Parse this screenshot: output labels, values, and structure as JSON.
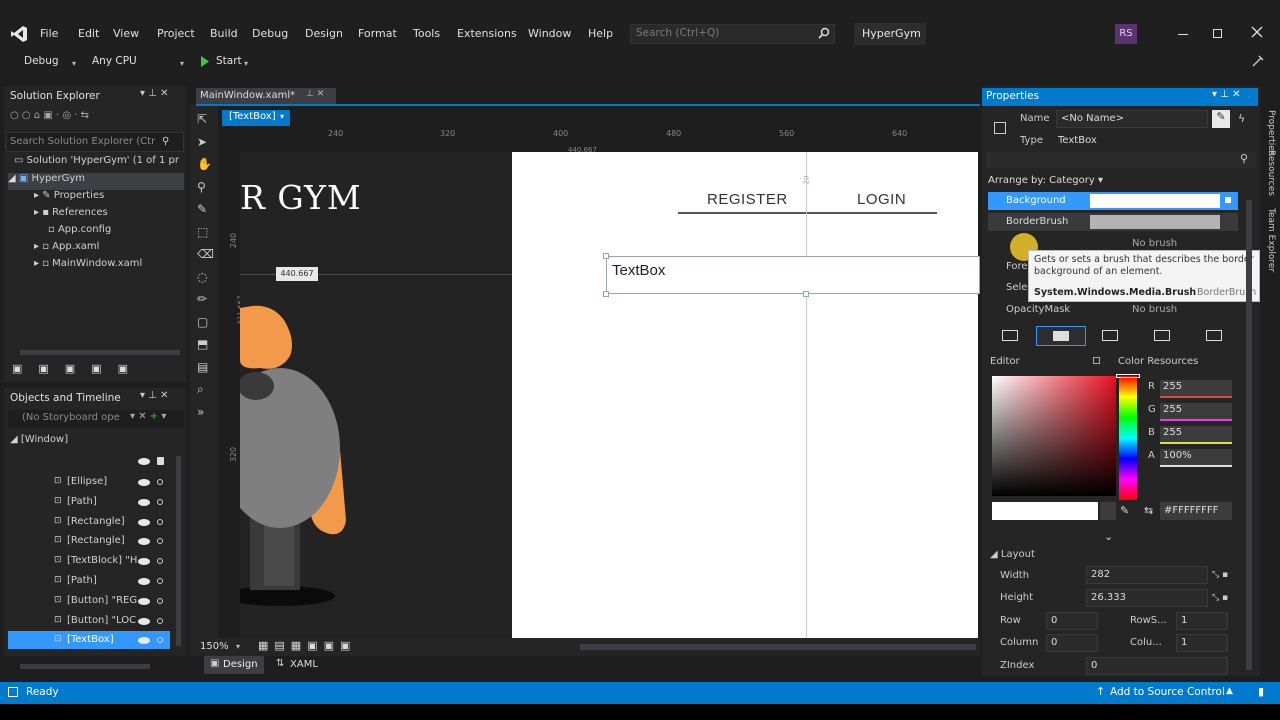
{
  "menu": [
    "File",
    "Edit",
    "View",
    "Project",
    "Build",
    "Debug",
    "Design",
    "Format",
    "Tools",
    "Extensions",
    "Window",
    "Help"
  ],
  "search": {
    "placeholder": "Search (Ctrl+Q)"
  },
  "solution_name": "HyperGym",
  "user_initials": "RS",
  "toolbar": {
    "config": "Debug",
    "platform": "Any CPU",
    "start": "Start"
  },
  "solution_explorer": {
    "title": "Solution Explorer",
    "search_placeholder": "Search Solution Explorer (Ctr",
    "items": [
      "Solution 'HyperGym' (1 of 1 pr",
      "HyperGym",
      "Properties",
      "References",
      "App.config",
      "App.xaml",
      "MainWindow.xaml"
    ]
  },
  "objects_timeline": {
    "title": "Objects and Timeline",
    "storyboard": "(No Storyboard ope",
    "root": "[Window]",
    "items": [
      "[Ellipse]",
      "[Path]",
      "[Rectangle]",
      "[Rectangle]",
      "[TextBlock] \"H",
      "[Path]",
      "[Button] \"REG",
      "[Button] \"LOC",
      "[TextBox]"
    ]
  },
  "document": {
    "tab": "MainWindow.xaml*",
    "selector": "[TextBox]",
    "ruler_top": [
      "240",
      "320",
      "400",
      "480",
      "560",
      "640"
    ],
    "ruler_left": [
      "240",
      "320"
    ],
    "dim_label_h": "440.667",
    "dim_label_top": "440.667",
    "dim_label_vert": "311.667",
    "dim_label_top_vert": "20",
    "logo_text": "R GYM",
    "nav_register": "REGISTER",
    "nav_login": "LOGIN",
    "textbox_text": "TextBox",
    "zoom": "150%",
    "design_tab": "Design",
    "xaml_tab": "XAML"
  },
  "properties": {
    "title": "Properties",
    "name_label": "Name",
    "name_value": "<No Name>",
    "type_label": "Type",
    "type_value": "TextBox",
    "arrange_by": "Arrange by: Category",
    "brush_rows": [
      "Background",
      "BorderBrush",
      "Foreground",
      "SelectionBrush",
      "OpacityMask"
    ],
    "no_brush": "No brush",
    "tooltip_line1": "Gets or sets a brush that describes the border",
    "tooltip_line2": "background of an element.",
    "tooltip_type": "System.Windows.Media.Brush",
    "tooltip_prop": "BorderBrush",
    "editor_label": "Editor",
    "color_resources": "Color Resources",
    "rgba_labels": [
      "R",
      "G",
      "B",
      "A"
    ],
    "rgba_values": [
      "255",
      "255",
      "255",
      "100%"
    ],
    "hex": "#FFFFFFFF",
    "layout_section": "Layout",
    "layout": {
      "width_label": "Width",
      "width": "282",
      "height_label": "Height",
      "height": "26.333",
      "row_label": "Row",
      "row": "0",
      "rowspan_label": "RowS...",
      "rowspan": "1",
      "column_label": "Column",
      "column": "0",
      "colspan_label": "Colu...",
      "colspan": "1",
      "zindex_label": "ZIndex",
      "zindex": "0"
    },
    "side_tabs": [
      "Properties",
      "Resources",
      "Team Explorer"
    ]
  },
  "status": {
    "ready": "Ready",
    "source_control": "Add to Source Control"
  },
  "colors": {
    "accent": "#007acc",
    "selected": "#3399ff",
    "orange": "#f2994a"
  }
}
